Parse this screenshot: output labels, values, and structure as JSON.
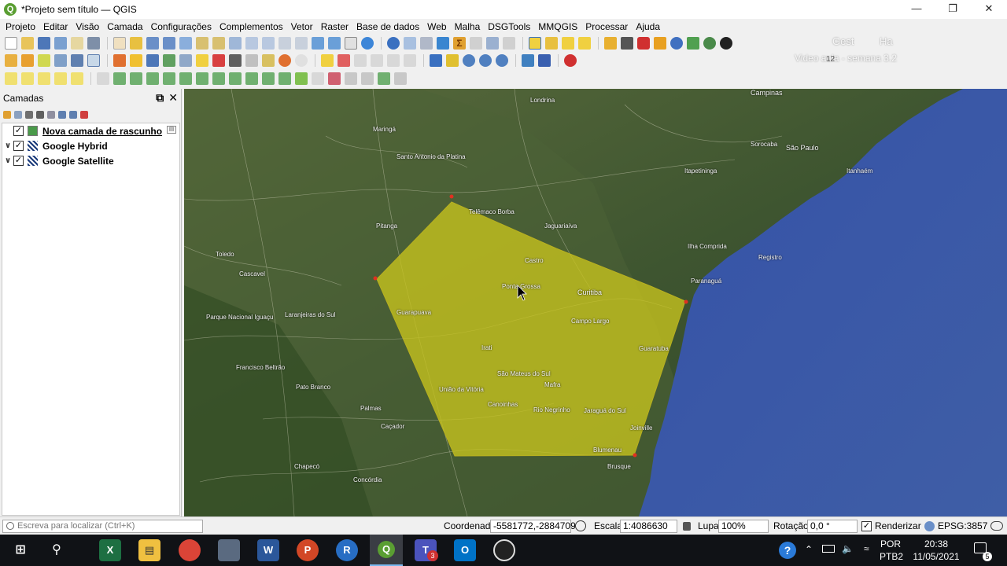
{
  "window": {
    "title": "*Projeto sem título — QGIS",
    "app_icon": "Q"
  },
  "menu": [
    "Projeto",
    "Editar",
    "Visão",
    "Camada",
    "Configurações",
    "Complementos",
    "Vetor",
    "Raster",
    "Base de dados",
    "Web",
    "Malha",
    "DSGTools",
    "MMQGIS",
    "Processar",
    "Ajuda"
  ],
  "overlay_text": {
    "line1": "Gest",
    "line1b": "Ha",
    "line2": "Video aula - semana 3.2",
    "zoom_label": "12"
  },
  "layers_panel": {
    "title": "Camadas",
    "layers": [
      {
        "name": "Nova camada de rascunho",
        "checked": true,
        "expanded": false,
        "icon": "scratch-layer-icon"
      },
      {
        "name": "Google Hybrid",
        "checked": true,
        "expanded": true,
        "icon": "raster-tile-icon"
      },
      {
        "name": "Google Satellite",
        "checked": true,
        "expanded": true,
        "icon": "raster-tile-icon"
      }
    ]
  },
  "map": {
    "polygon_fill": "#c8c41e",
    "ocean_color": "#3e5aa3",
    "labels": [
      {
        "text": "Campinas"
      },
      {
        "text": "São Paulo"
      },
      {
        "text": "Curitiba"
      },
      {
        "text": "Cascavel"
      },
      {
        "text": "Toledo"
      },
      {
        "text": "Guarapuava"
      },
      {
        "text": "Ponta Grossa"
      },
      {
        "text": "Pato Branco"
      },
      {
        "text": "Chapecó"
      },
      {
        "text": "Joinville"
      },
      {
        "text": "Blumenau"
      },
      {
        "text": "Brusque"
      },
      {
        "text": "Concórdia"
      },
      {
        "text": "Sorocaba"
      },
      {
        "text": "Paranaguá"
      },
      {
        "text": "Parque Nacional Iguaçu"
      },
      {
        "text": "Londrina"
      },
      {
        "text": "Maringá"
      },
      {
        "text": "Irati"
      },
      {
        "text": "São Mateus do Sul"
      },
      {
        "text": "União da Vitória"
      },
      {
        "text": "Caçador"
      },
      {
        "text": "Mafra"
      },
      {
        "text": "Santo Antonio da Platina"
      },
      {
        "text": "Registro"
      },
      {
        "text": "Itapetininga"
      },
      {
        "text": "Telêmaco Borba"
      },
      {
        "text": "Castro"
      },
      {
        "text": "Campo Largo"
      },
      {
        "text": "Jaguariaíva"
      },
      {
        "text": "Pitanga"
      },
      {
        "text": "Laranjeiras do Sul"
      },
      {
        "text": "Francisco Beltrão"
      },
      {
        "text": "Palmas"
      },
      {
        "text": "Canoinhas"
      },
      {
        "text": "Rio Negrinho"
      },
      {
        "text": "Jaraguá do Sul"
      },
      {
        "text": "Guaratuba"
      },
      {
        "text": "Itanhaém"
      },
      {
        "text": "Ilha Comprida"
      }
    ]
  },
  "statusbar": {
    "locator_placeholder": "Escreva para localizar (Ctrl+K)",
    "coord_label": "Coordenada",
    "coord_value": "-5581772,-2884709",
    "scale_label": "Escala",
    "scale_value": "1:4086630",
    "magnifier_label": "Lupa",
    "magnifier_value": "100%",
    "rotation_label": "Rotação",
    "rotation_value": "0,0 °",
    "render_label": "Renderizar",
    "render_checked": true,
    "crs": "EPSG:3857"
  },
  "taskbar": {
    "apps": [
      "windows-start",
      "search",
      "excel",
      "file-explorer",
      "chrome",
      "camera-app",
      "word",
      "powerpoint",
      "r-app",
      "qgis",
      "teams",
      "outlook",
      "obs"
    ],
    "teams_badge": "3",
    "lang_primary": "POR",
    "lang_secondary": "PTB2",
    "time": "20:38",
    "date": "11/05/2021",
    "notification_count": "5"
  }
}
